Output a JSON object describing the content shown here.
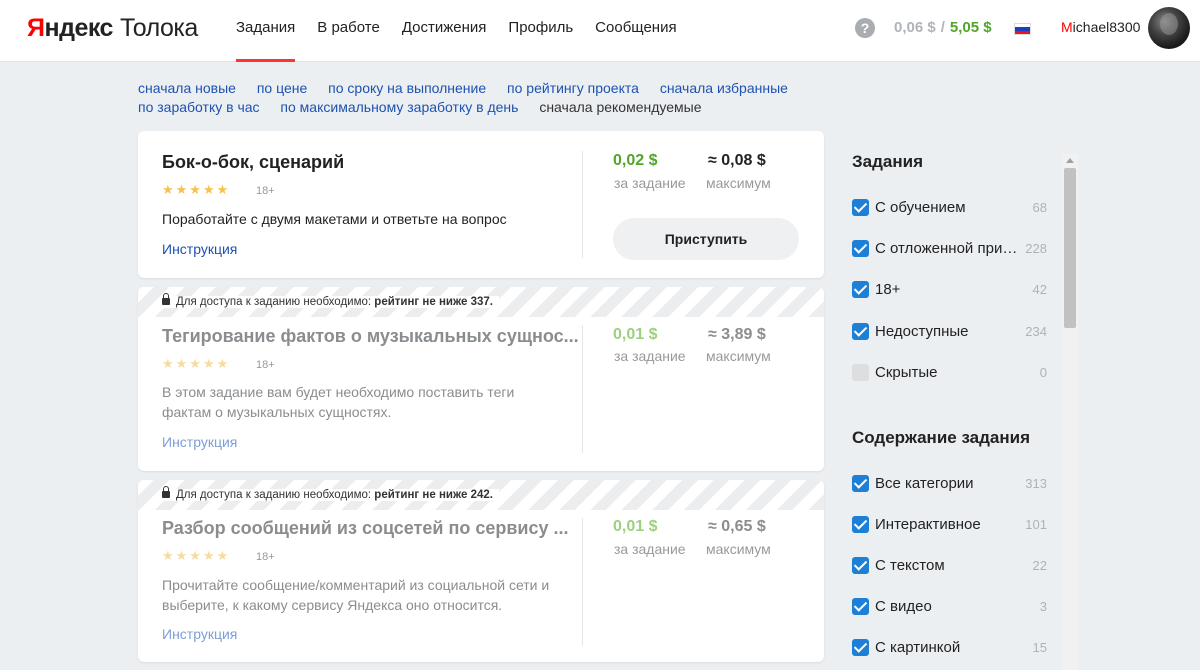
{
  "header": {
    "logo_brand_first": "Я",
    "logo_brand_rest": "ндекс",
    "logo_product": "Толока",
    "nav": [
      "Задания",
      "В работе",
      "Достижения",
      "Профиль",
      "Сообщения"
    ],
    "help_icon": "question-circle-icon",
    "balance_pending": "0,06 $",
    "balance_separator": "/",
    "balance_available": "5,05 $",
    "language_flag": "flag-ru-icon",
    "username_first": "M",
    "username_rest": "ichael8300"
  },
  "sort": {
    "options": [
      "сначала новые",
      "по цене",
      "по сроку на выполнение",
      "по рейтингу проекта",
      "сначала избранные",
      "по заработку в час",
      "по максимальному заработку в день"
    ],
    "current": "сначала рекомендуемые"
  },
  "tasks": [
    {
      "title": "Бок-о-бок, сценарий",
      "stars": "★★★★★",
      "age": "18+",
      "description": "Поработайте с двумя макетами и ответьте на вопрос",
      "instruction": "Инструкция",
      "price": "0,02 $",
      "price_label": "за задание",
      "max": "≈ 0,08 $",
      "max_label": "максимум",
      "action": "Приступить"
    },
    {
      "lock_prefix": "Для доступа к заданию необходимо:",
      "lock_requirement": "рейтинг не ниже 337.",
      "title": "Тегирование фактов о музыкальных сущнос...",
      "stars": "★★★★★",
      "age": "18+",
      "description": "В этом задание вам будет необходимо поставить теги фактам о музыкальных сущностях.",
      "instruction": "Инструкция",
      "price": "0,01 $",
      "price_label": "за задание",
      "max": "≈ 3,89 $",
      "max_label": "максимум"
    },
    {
      "lock_prefix": "Для доступа к заданию необходимо:",
      "lock_requirement": "рейтинг не ниже 242.",
      "title": "Разбор сообщений из соцсетей по сервису ...",
      "stars": "★★★★★",
      "age": "18+",
      "description": "Прочитайте сообщение/комментарий из социальной сети и выберите, к какому сервису Яндекса оно относится.",
      "instruction": "Инструкция",
      "price": "0,01 $",
      "price_label": "за задание",
      "max": "≈ 0,65 $",
      "max_label": "максимум"
    }
  ],
  "sidebar": {
    "section1_title": "Задания",
    "section1": [
      {
        "label": "С обучением",
        "count": "68",
        "checked": true
      },
      {
        "label": "С отложенной приёмкой",
        "count": "228",
        "checked": true
      },
      {
        "label": "18+",
        "count": "42",
        "checked": true
      },
      {
        "label": "Недоступные",
        "count": "234",
        "checked": true
      },
      {
        "label": "Скрытые",
        "count": "0",
        "checked": false
      }
    ],
    "section2_title": "Содержание задания",
    "section2": [
      {
        "label": "Все категории",
        "count": "313",
        "checked": true
      },
      {
        "label": "Интерактивное",
        "count": "101",
        "checked": true
      },
      {
        "label": "С текстом",
        "count": "22",
        "checked": true
      },
      {
        "label": "С видео",
        "count": "3",
        "checked": true
      },
      {
        "label": "С картинкой",
        "count": "15",
        "checked": true
      }
    ]
  },
  "colors": {
    "accent_red": "#ff3333",
    "link_blue": "#1d52b0",
    "money_green": "#52a529",
    "checkbox_blue": "#1e7fd6"
  }
}
